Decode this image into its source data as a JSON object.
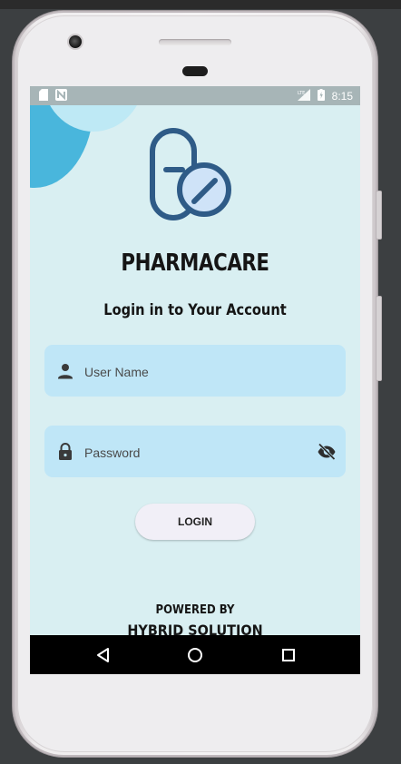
{
  "status_bar": {
    "time": "8:15"
  },
  "app": {
    "name": "PHARMACARE",
    "subtitle": "Login in to Your Account"
  },
  "form": {
    "username_placeholder": "User Name",
    "password_placeholder": "Password",
    "login_label": "LOGIN"
  },
  "footer": {
    "powered_by": "POWERED BY",
    "company": "HYBRID SOLUTION"
  },
  "icons": {
    "logo": "pill-capsule-icon",
    "user": "person-icon",
    "lock": "lock-icon",
    "visibility": "eye-off-icon",
    "nav_back": "triangle-back-icon",
    "nav_home": "circle-home-icon",
    "nav_recent": "square-recents-icon"
  },
  "colors": {
    "screen_bg": "#d9eff2",
    "field_bg": "#bfe6f7",
    "accent_circle": "#49b6dc",
    "logo_stroke": "#2f5b87",
    "logo_fill": "#cfe3f8"
  }
}
